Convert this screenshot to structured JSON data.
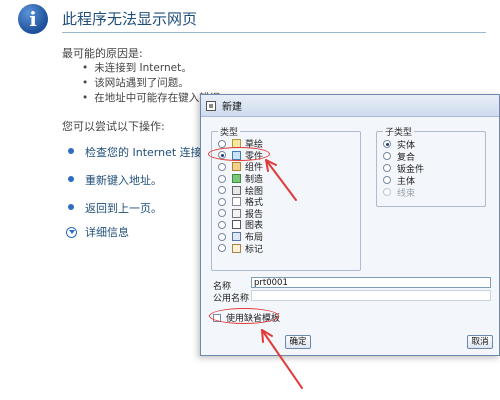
{
  "error_page": {
    "title": "此程序无法显示网页",
    "reasons_title": "最可能的原因是:",
    "reasons": [
      "未连接到 Internet。",
      "该网站遇到了问题。",
      "在地址中可能存在键入错误"
    ],
    "try_title": "您可以尝试以下操作:",
    "actions": [
      "检查您的 Internet 连接。",
      "重新键入地址。",
      "返回到上一页。"
    ],
    "details_label": "详细信息"
  },
  "dialog": {
    "title": "新建",
    "type_group_label": "类型",
    "types": [
      {
        "label": "草绘",
        "icon": "sketch-icon"
      },
      {
        "label": "零件",
        "icon": "part-icon",
        "selected": true
      },
      {
        "label": "组件",
        "icon": "assembly-icon"
      },
      {
        "label": "制造",
        "icon": "manufacturing-icon"
      },
      {
        "label": "绘图",
        "icon": "drawing-icon"
      },
      {
        "label": "格式",
        "icon": "format-icon"
      },
      {
        "label": "报告",
        "icon": "report-icon"
      },
      {
        "label": "图表",
        "icon": "diagram-icon"
      },
      {
        "label": "布局",
        "icon": "layout-icon"
      },
      {
        "label": "标记",
        "icon": "markup-icon"
      }
    ],
    "subtype_group_label": "子类型",
    "subtypes": [
      {
        "label": "实体",
        "selected": true
      },
      {
        "label": "复合"
      },
      {
        "label": "钣金件"
      },
      {
        "label": "主体"
      },
      {
        "label": "线束",
        "disabled": true
      }
    ],
    "name_label": "名称",
    "name_value": "prt0001",
    "common_name_label": "公用名称",
    "common_name_value": "",
    "use_default_template_label": "使用缺省模板",
    "use_default_template_checked": false,
    "ok_label": "确定",
    "cancel_label": "取消"
  },
  "colors": {
    "annotation": "#e23a3a",
    "link": "#1f4e79"
  }
}
